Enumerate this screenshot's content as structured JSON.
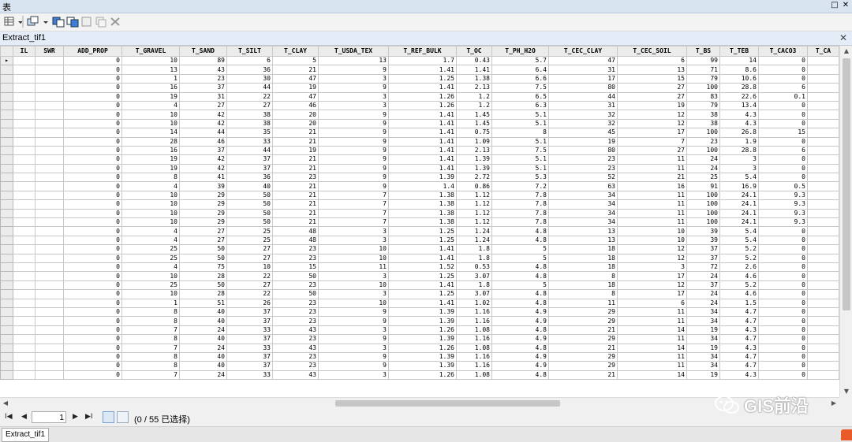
{
  "window": {
    "title": "表"
  },
  "table_window": {
    "title": "Extract_tif1"
  },
  "columns": [
    "",
    "IL",
    "SWR",
    "ADD_PROP",
    "T_GRAVEL",
    "T_SAND",
    "T_SILT",
    "T_CLAY",
    "T_USDA_TEX",
    "T_REF_BULK",
    "T_OC",
    "T_PH_H2O",
    "T_CEC_CLAY",
    "T_CEC_SOIL",
    "T_BS",
    "T_TEB",
    "T_CACO3",
    "T_CA"
  ],
  "rows": [
    [
      "",
      "",
      "",
      "0",
      "10",
      "89",
      "6",
      "5",
      "13",
      "1.7",
      "0.43",
      "5.7",
      "47",
      "6",
      "99",
      "14",
      "0",
      ""
    ],
    [
      "",
      "",
      "",
      "0",
      "13",
      "43",
      "36",
      "21",
      "9",
      "1.41",
      "1.41",
      "6.4",
      "31",
      "13",
      "71",
      "8.6",
      "0",
      ""
    ],
    [
      "",
      "",
      "",
      "0",
      "1",
      "23",
      "30",
      "47",
      "3",
      "1.25",
      "1.38",
      "6.6",
      "17",
      "15",
      "79",
      "10.6",
      "0",
      ""
    ],
    [
      "",
      "",
      "",
      "0",
      "16",
      "37",
      "44",
      "19",
      "9",
      "1.41",
      "2.13",
      "7.5",
      "80",
      "27",
      "100",
      "28.8",
      "6",
      ""
    ],
    [
      "",
      "",
      "",
      "0",
      "19",
      "31",
      "22",
      "47",
      "3",
      "1.26",
      "1.2",
      "6.5",
      "44",
      "27",
      "83",
      "22.6",
      "0.1",
      ""
    ],
    [
      "",
      "",
      "",
      "0",
      "4",
      "27",
      "27",
      "46",
      "3",
      "1.26",
      "1.2",
      "6.3",
      "31",
      "19",
      "79",
      "13.4",
      "0",
      ""
    ],
    [
      "",
      "",
      "",
      "0",
      "10",
      "42",
      "38",
      "20",
      "9",
      "1.41",
      "1.45",
      "5.1",
      "32",
      "12",
      "38",
      "4.3",
      "0",
      ""
    ],
    [
      "",
      "",
      "",
      "0",
      "10",
      "42",
      "38",
      "20",
      "9",
      "1.41",
      "1.45",
      "5.1",
      "32",
      "12",
      "38",
      "4.3",
      "0",
      ""
    ],
    [
      "",
      "",
      "",
      "0",
      "14",
      "44",
      "35",
      "21",
      "9",
      "1.41",
      "0.75",
      "8",
      "45",
      "17",
      "100",
      "26.8",
      "15",
      ""
    ],
    [
      "",
      "",
      "",
      "0",
      "28",
      "46",
      "33",
      "21",
      "9",
      "1.41",
      "1.09",
      "5.1",
      "19",
      "7",
      "23",
      "1.9",
      "0",
      ""
    ],
    [
      "",
      "",
      "",
      "0",
      "16",
      "37",
      "44",
      "19",
      "9",
      "1.41",
      "2.13",
      "7.5",
      "80",
      "27",
      "100",
      "28.8",
      "6",
      ""
    ],
    [
      "",
      "",
      "",
      "0",
      "19",
      "42",
      "37",
      "21",
      "9",
      "1.41",
      "1.39",
      "5.1",
      "23",
      "11",
      "24",
      "3",
      "0",
      ""
    ],
    [
      "",
      "",
      "",
      "0",
      "19",
      "42",
      "37",
      "21",
      "9",
      "1.41",
      "1.39",
      "5.1",
      "23",
      "11",
      "24",
      "3",
      "0",
      ""
    ],
    [
      "",
      "",
      "",
      "0",
      "8",
      "41",
      "36",
      "23",
      "9",
      "1.39",
      "2.72",
      "5.3",
      "52",
      "21",
      "25",
      "5.4",
      "0",
      ""
    ],
    [
      "",
      "",
      "",
      "0",
      "4",
      "39",
      "40",
      "21",
      "9",
      "1.4",
      "0.86",
      "7.2",
      "63",
      "16",
      "91",
      "16.9",
      "0.5",
      ""
    ],
    [
      "",
      "",
      "",
      "0",
      "10",
      "29",
      "50",
      "21",
      "7",
      "1.38",
      "1.12",
      "7.8",
      "34",
      "11",
      "100",
      "24.1",
      "9.3",
      ""
    ],
    [
      "",
      "",
      "",
      "0",
      "10",
      "29",
      "50",
      "21",
      "7",
      "1.38",
      "1.12",
      "7.8",
      "34",
      "11",
      "100",
      "24.1",
      "9.3",
      ""
    ],
    [
      "",
      "",
      "",
      "0",
      "10",
      "29",
      "50",
      "21",
      "7",
      "1.38",
      "1.12",
      "7.8",
      "34",
      "11",
      "100",
      "24.1",
      "9.3",
      ""
    ],
    [
      "",
      "",
      "",
      "0",
      "10",
      "29",
      "50",
      "21",
      "7",
      "1.38",
      "1.12",
      "7.8",
      "34",
      "11",
      "100",
      "24.1",
      "9.3",
      ""
    ],
    [
      "",
      "",
      "",
      "0",
      "4",
      "27",
      "25",
      "48",
      "3",
      "1.25",
      "1.24",
      "4.8",
      "13",
      "10",
      "39",
      "5.4",
      "0",
      ""
    ],
    [
      "",
      "",
      "",
      "0",
      "4",
      "27",
      "25",
      "48",
      "3",
      "1.25",
      "1.24",
      "4.8",
      "13",
      "10",
      "39",
      "5.4",
      "0",
      ""
    ],
    [
      "",
      "",
      "",
      "0",
      "25",
      "50",
      "27",
      "23",
      "10",
      "1.41",
      "1.8",
      "5",
      "18",
      "12",
      "37",
      "5.2",
      "0",
      ""
    ],
    [
      "",
      "",
      "",
      "0",
      "25",
      "50",
      "27",
      "23",
      "10",
      "1.41",
      "1.8",
      "5",
      "18",
      "12",
      "37",
      "5.2",
      "0",
      ""
    ],
    [
      "",
      "",
      "",
      "0",
      "4",
      "75",
      "10",
      "15",
      "11",
      "1.52",
      "0.53",
      "4.8",
      "18",
      "3",
      "72",
      "2.6",
      "0",
      ""
    ],
    [
      "",
      "",
      "",
      "0",
      "10",
      "28",
      "22",
      "50",
      "3",
      "1.25",
      "3.07",
      "4.8",
      "8",
      "17",
      "24",
      "4.6",
      "0",
      ""
    ],
    [
      "",
      "",
      "",
      "0",
      "25",
      "50",
      "27",
      "23",
      "10",
      "1.41",
      "1.8",
      "5",
      "18",
      "12",
      "37",
      "5.2",
      "0",
      ""
    ],
    [
      "",
      "",
      "",
      "0",
      "10",
      "28",
      "22",
      "50",
      "3",
      "1.25",
      "3.07",
      "4.8",
      "8",
      "17",
      "24",
      "4.6",
      "0",
      ""
    ],
    [
      "",
      "",
      "",
      "0",
      "1",
      "51",
      "26",
      "23",
      "10",
      "1.41",
      "1.02",
      "4.8",
      "11",
      "6",
      "24",
      "1.5",
      "0",
      ""
    ],
    [
      "",
      "",
      "",
      "0",
      "8",
      "40",
      "37",
      "23",
      "9",
      "1.39",
      "1.16",
      "4.9",
      "29",
      "11",
      "34",
      "4.7",
      "0",
      ""
    ],
    [
      "",
      "",
      "",
      "0",
      "8",
      "40",
      "37",
      "23",
      "9",
      "1.39",
      "1.16",
      "4.9",
      "29",
      "11",
      "34",
      "4.7",
      "0",
      ""
    ],
    [
      "",
      "",
      "",
      "0",
      "7",
      "24",
      "33",
      "43",
      "3",
      "1.26",
      "1.08",
      "4.8",
      "21",
      "14",
      "19",
      "4.3",
      "0",
      ""
    ],
    [
      "",
      "",
      "",
      "0",
      "8",
      "40",
      "37",
      "23",
      "9",
      "1.39",
      "1.16",
      "4.9",
      "29",
      "11",
      "34",
      "4.7",
      "0",
      ""
    ],
    [
      "",
      "",
      "",
      "0",
      "7",
      "24",
      "33",
      "43",
      "3",
      "1.26",
      "1.08",
      "4.8",
      "21",
      "14",
      "19",
      "4.3",
      "0",
      ""
    ],
    [
      "",
      "",
      "",
      "0",
      "8",
      "40",
      "37",
      "23",
      "9",
      "1.39",
      "1.16",
      "4.9",
      "29",
      "11",
      "34",
      "4.7",
      "0",
      ""
    ],
    [
      "",
      "",
      "",
      "0",
      "8",
      "40",
      "37",
      "23",
      "9",
      "1.39",
      "1.16",
      "4.9",
      "29",
      "11",
      "34",
      "4.7",
      "0",
      ""
    ],
    [
      "",
      "",
      "",
      "0",
      "7",
      "24",
      "33",
      "43",
      "3",
      "1.26",
      "1.08",
      "4.8",
      "21",
      "14",
      "19",
      "4.3",
      "0",
      ""
    ]
  ],
  "nav": {
    "first": "I◀",
    "prev": "◀",
    "record": "1",
    "next": "▶",
    "last": "▶I",
    "selection": "(0 / 55 已选择)"
  },
  "bottom_tab": "Extract_tif1",
  "watermark": "GIS前沿",
  "colors": {
    "title_bg": "#d9e4f1",
    "header_bg": "#ececec",
    "grid_line": "#c8c8c8"
  }
}
